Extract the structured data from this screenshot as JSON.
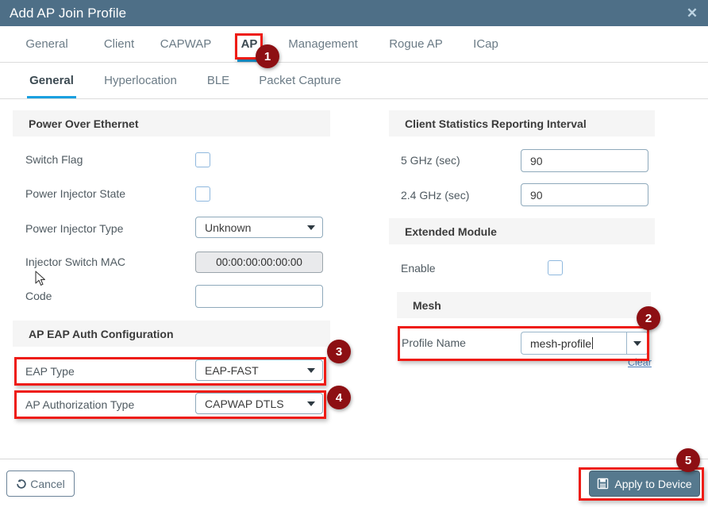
{
  "window": {
    "title": "Add AP Join Profile",
    "close_icon": "close-icon"
  },
  "tabs_primary": [
    {
      "label": "General",
      "active": false
    },
    {
      "label": "Client",
      "active": false
    },
    {
      "label": "CAPWAP",
      "active": false
    },
    {
      "label": "AP",
      "active": true
    },
    {
      "label": "Management",
      "active": false
    },
    {
      "label": "Rogue AP",
      "active": false
    },
    {
      "label": "ICap",
      "active": false
    }
  ],
  "tabs_secondary": [
    {
      "label": "General",
      "active": true
    },
    {
      "label": "Hyperlocation",
      "active": false
    },
    {
      "label": "BLE",
      "active": false
    },
    {
      "label": "Packet Capture",
      "active": false
    }
  ],
  "left": {
    "poe": {
      "header": "Power Over Ethernet",
      "switch_flag_label": "Switch Flag",
      "switch_flag_checked": false,
      "power_injector_state_label": "Power Injector State",
      "power_injector_state_checked": false,
      "power_injector_type_label": "Power Injector Type",
      "power_injector_type_value": "Unknown",
      "injector_switch_mac_label": "Injector Switch MAC",
      "injector_switch_mac_value": "00:00:00:00:00:00",
      "code_label": "Code",
      "code_value": "",
      "code_placeholder": ""
    },
    "eap": {
      "header": "AP EAP Auth Configuration",
      "eap_type_label": "EAP Type",
      "eap_type_value": "EAP-FAST",
      "ap_authorization_type_label": "AP Authorization Type",
      "ap_authorization_type_value": "CAPWAP DTLS"
    }
  },
  "right": {
    "client_stats": {
      "header": "Client Statistics Reporting Interval",
      "ghz5_label": "5 GHz (sec)",
      "ghz5_value": "90",
      "ghz24_label": "2.4 GHz (sec)",
      "ghz24_value": "90"
    },
    "extended_module": {
      "header": "Extended Module",
      "enable_label": "Enable",
      "enable_checked": false
    },
    "mesh": {
      "header": "Mesh",
      "profile_name_label": "Profile Name",
      "profile_name_value": "mesh-profile",
      "clear_label": "Clear"
    }
  },
  "footer": {
    "cancel_label": "Cancel",
    "cancel_icon": "undo-icon",
    "apply_label": "Apply to Device",
    "apply_icon": "save-icon"
  },
  "annotations": {
    "badges": [
      "1",
      "2",
      "3",
      "4",
      "5"
    ]
  },
  "colors": {
    "titlebar": "#4e6f87",
    "accent_tab": "#1aa0e0",
    "highlight_red": "#ee1c15",
    "badge_red": "#8d0f13",
    "apply_button": "#56798e"
  }
}
